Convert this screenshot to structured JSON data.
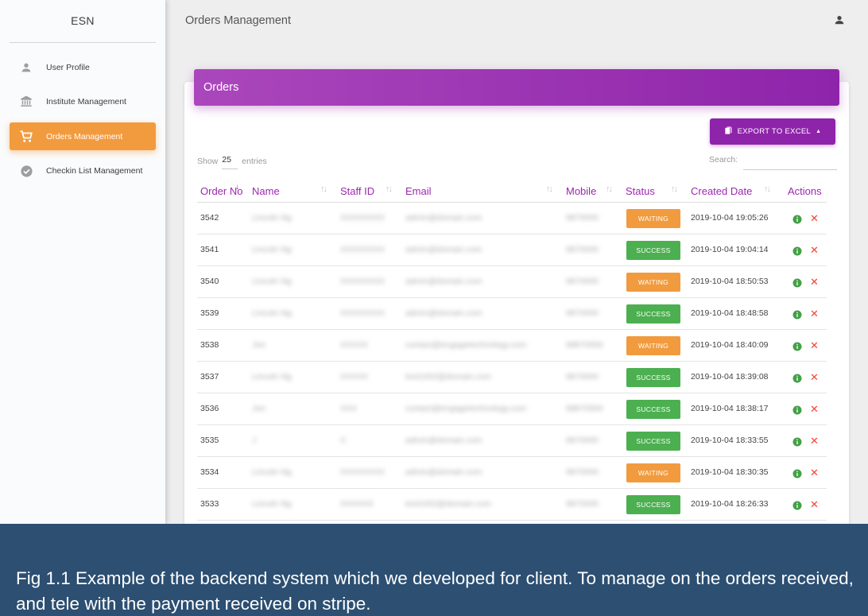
{
  "sidebar": {
    "brand": "ESN",
    "items": [
      {
        "label": "User Profile",
        "icon": "person-icon",
        "active": false
      },
      {
        "label": "Institute Management",
        "icon": "institution-icon",
        "active": false
      },
      {
        "label": "Orders Management",
        "icon": "cart-icon",
        "active": true
      },
      {
        "label": "Checkin List Management",
        "icon": "check-circle-icon",
        "active": false
      }
    ]
  },
  "topbar": {
    "title": "Orders Management",
    "user_icon": "person-icon"
  },
  "card": {
    "title": "Orders",
    "export_label": "EXPORT TO EXCEL",
    "show_label": "Show",
    "show_value": "25",
    "entries_label": "entries",
    "search_label": "Search:",
    "search_value": ""
  },
  "table": {
    "columns": [
      "Order No",
      "Name",
      "Staff ID",
      "Email",
      "Mobile",
      "Status",
      "Created Date",
      "Actions"
    ],
    "rows": [
      {
        "order_no": "3542",
        "name": "Lincoln Ng",
        "staff_id": "XXXXXXXX",
        "email": "admin@domain.com",
        "mobile": "9870000",
        "status": "WAITING",
        "created": "2019-10-04 19:05:26"
      },
      {
        "order_no": "3541",
        "name": "Lincoln Ng",
        "staff_id": "XXXXXXXX",
        "email": "admin@domain.com",
        "mobile": "9870000",
        "status": "SUCCESS",
        "created": "2019-10-04 19:04:14"
      },
      {
        "order_no": "3540",
        "name": "Lincoln Ng",
        "staff_id": "XXXXXXXX",
        "email": "admin@domain.com",
        "mobile": "9870000",
        "status": "WAITING",
        "created": "2019-10-04 18:50:53"
      },
      {
        "order_no": "3539",
        "name": "Lincoln Ng",
        "staff_id": "XXXXXXXX",
        "email": "admin@domain.com",
        "mobile": "9870000",
        "status": "SUCCESS",
        "created": "2019-10-04 18:48:58"
      },
      {
        "order_no": "3538",
        "name": "Jon",
        "staff_id": "XXXXX",
        "email": "contact@engagetechnology.com",
        "mobile": "98870000",
        "status": "WAITING",
        "created": "2019-10-04 18:40:09"
      },
      {
        "order_no": "3537",
        "name": "Lincoln Ng",
        "staff_id": "XXXXX",
        "email": "test1002@domain.com",
        "mobile": "9870000",
        "status": "SUCCESS",
        "created": "2019-10-04 18:39:08"
      },
      {
        "order_no": "3536",
        "name": "Jon",
        "staff_id": "XXX",
        "email": "contact@engagetechnology.com",
        "mobile": "98870000",
        "status": "SUCCESS",
        "created": "2019-10-04 18:38:17"
      },
      {
        "order_no": "3535",
        "name": "J",
        "staff_id": "X",
        "email": "admin@domain.com",
        "mobile": "9870000",
        "status": "SUCCESS",
        "created": "2019-10-04 18:33:55"
      },
      {
        "order_no": "3534",
        "name": "Lincoln Ng",
        "staff_id": "XXXXXXXX",
        "email": "admin@domain.com",
        "mobile": "9870000",
        "status": "WAITING",
        "created": "2019-10-04 18:30:35"
      },
      {
        "order_no": "3533",
        "name": "Lincoln Ng",
        "staff_id": "XXXXXX",
        "email": "test1002@domain.com",
        "mobile": "9870000",
        "status": "SUCCESS",
        "created": "2019-10-04 18:26:33"
      }
    ]
  },
  "colors": {
    "primary": "#9c27b0",
    "accent": "#f29b3e",
    "success": "#4caf50",
    "danger": "#f44336",
    "info": "#43a047"
  },
  "caption": "Fig 1.1 Example of the backend system which we developed for client. To manage on the orders received, and tele with the payment received on stripe."
}
